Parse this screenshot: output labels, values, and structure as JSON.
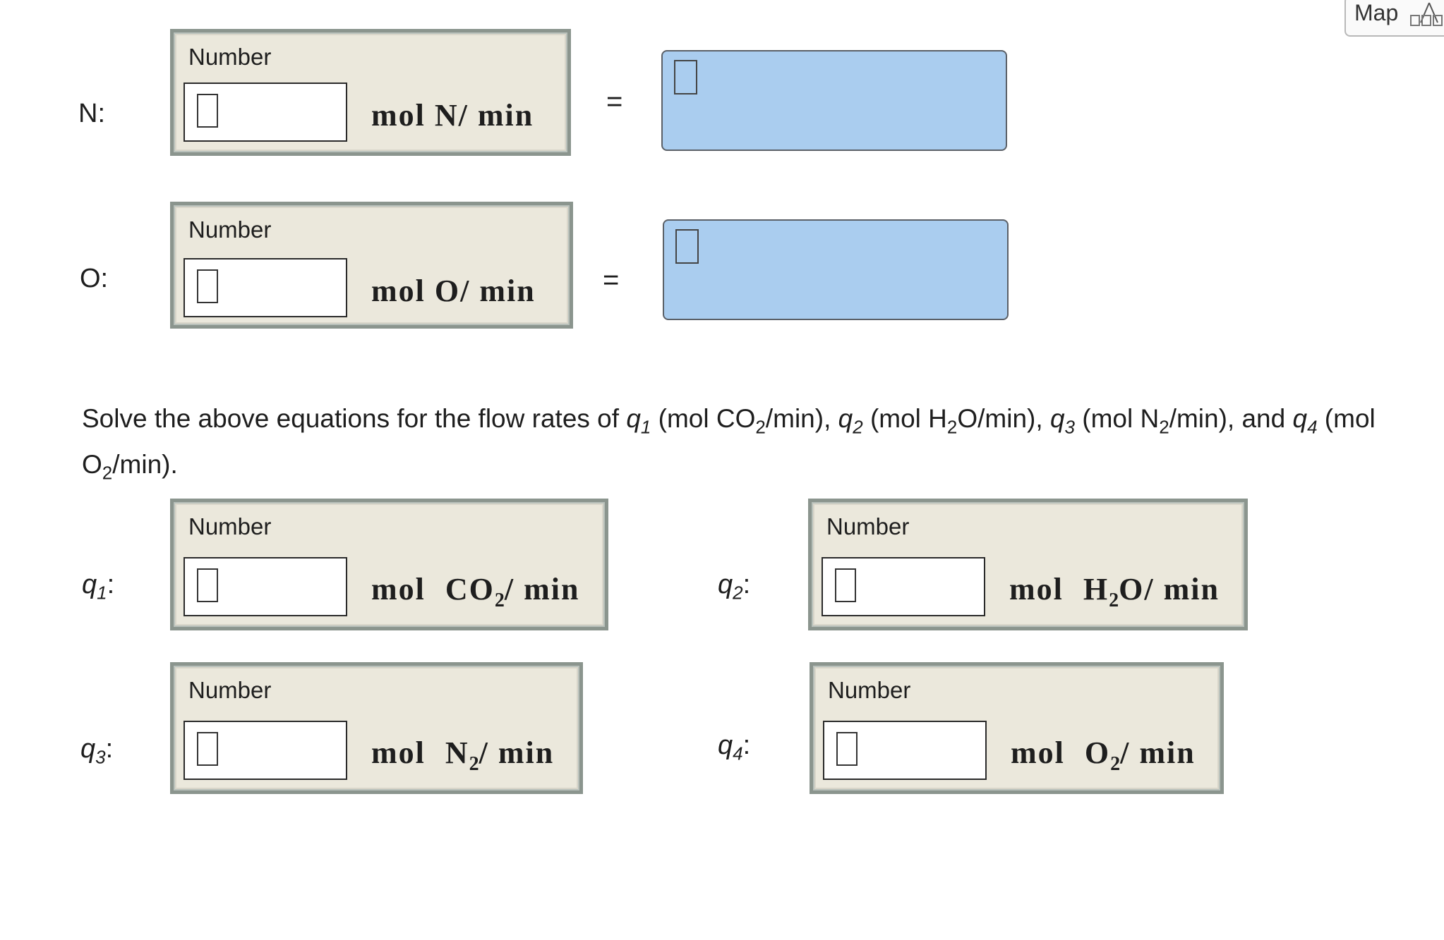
{
  "map_button": {
    "label": "Map"
  },
  "element_rows": [
    {
      "label": "N:",
      "header": "Number",
      "value": "",
      "unit": "mol  N/ min",
      "equals": "="
    },
    {
      "label": "O:",
      "header": "Number",
      "value": "",
      "unit": "mol  O/ min",
      "equals": "="
    }
  ],
  "instruction": {
    "text": "Solve the above equations for the flow rates of q1 (mol CO2/min), q2 (mol H2O/min), q3 (mol N2/min), and q4 (mol O2/min)."
  },
  "flow_rates": [
    {
      "var": "q",
      "sub": "1",
      "suffix": ":",
      "header": "Number",
      "value": "",
      "unit_main": "CO",
      "unit_sub": "2"
    },
    {
      "var": "q",
      "sub": "2",
      "suffix": ":",
      "header": "Number",
      "value": "",
      "unit_main": "H",
      "unit_sub": "2",
      "unit_tail": "O"
    },
    {
      "var": "q",
      "sub": "3",
      "suffix": ":",
      "header": "Number",
      "value": "",
      "unit_main": "N",
      "unit_sub": "2"
    },
    {
      "var": "q",
      "sub": "4",
      "suffix": ":",
      "header": "Number",
      "value": "",
      "unit_main": "O",
      "unit_sub": "2"
    }
  ],
  "unit_words": {
    "mol": "mol",
    "per_min": "/ min"
  }
}
